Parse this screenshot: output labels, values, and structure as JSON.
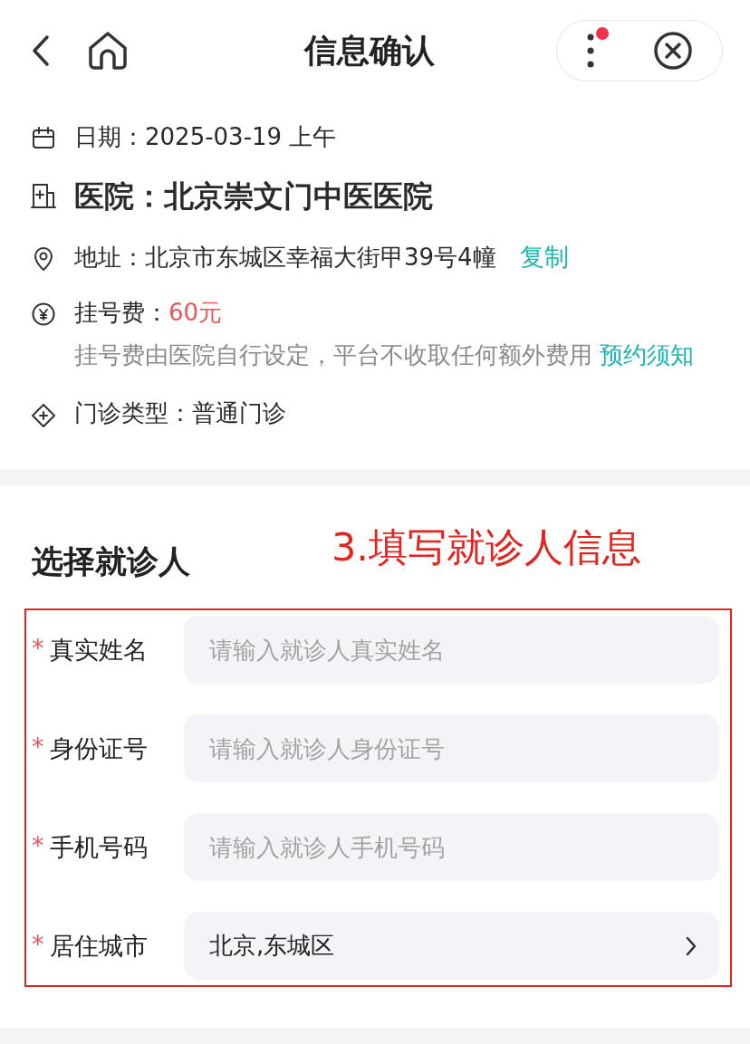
{
  "header": {
    "title": "信息确认",
    "has_notification": true
  },
  "info_rows": [
    {
      "kind": "date",
      "label": "日期：",
      "value": "2025-03-19 上午"
    },
    {
      "kind": "hospital",
      "label": "医院：",
      "value": "北京崇文门中医医院"
    },
    {
      "kind": "address",
      "label": "地址：",
      "value": "北京市东城区幸福大街甲39号4幢",
      "action": "复制"
    },
    {
      "kind": "fee",
      "label": "挂号费：",
      "value": "60元",
      "note": "挂号费由医院自行设定，平台不收取任何额外费用",
      "note_link": "预约须知"
    },
    {
      "kind": "type",
      "label": "门诊类型：",
      "value": "普通门诊"
    }
  ],
  "patient_section": {
    "title": "选择就诊人",
    "annotation": "3.填写就诊人信息",
    "fields": [
      {
        "kind": "text",
        "required_mark": "*",
        "label": "真实姓名",
        "placeholder": "请输入就诊人真实姓名"
      },
      {
        "kind": "text",
        "required_mark": "*",
        "label": "身份证号",
        "placeholder": "请输入就诊人身份证号"
      },
      {
        "kind": "text",
        "required_mark": "*",
        "label": "手机号码",
        "placeholder": "请输入就诊人手机号码"
      },
      {
        "kind": "select",
        "required_mark": "*",
        "label": "居住城市",
        "value": "北京,东城区"
      }
    ]
  }
}
